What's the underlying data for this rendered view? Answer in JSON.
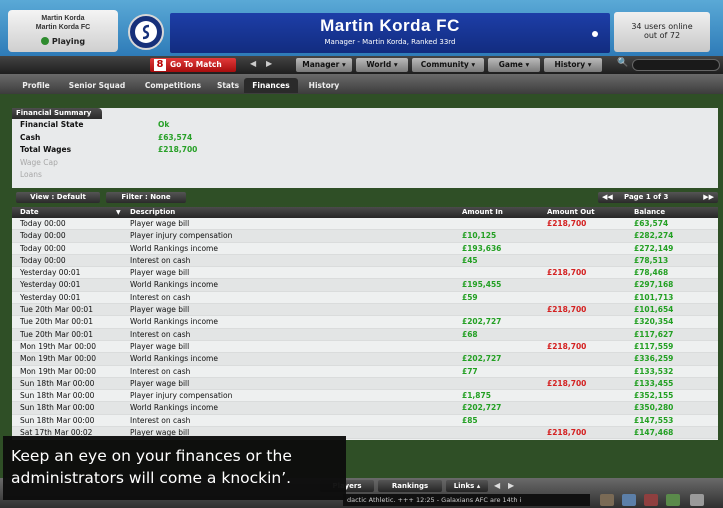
{
  "header": {
    "manager_name": "Martin Korda",
    "team_line": "Martin Korda FC",
    "status": "Playing",
    "club_name": "Martin Korda FC",
    "subtitle": "Manager - Martin Korda, Ranked 33rd",
    "online_line1": "34 users online",
    "online_line2": "out of 72"
  },
  "nav": {
    "go_to_match": "Go To Match",
    "menus": [
      "Manager ▾",
      "World ▾",
      "Community ▾",
      "Game ▾",
      "History ▾"
    ]
  },
  "tabs": [
    "Profile",
    "Senior Squad",
    "Competitions",
    "Stats",
    "Finances",
    "History"
  ],
  "active_tab": "Finances",
  "summary": {
    "title": "Financial Summary",
    "rows": [
      {
        "label": "Financial State",
        "value": "Ok"
      },
      {
        "label": "Cash",
        "value": "£63,574"
      },
      {
        "label": "Total Wages",
        "value": "£218,700"
      },
      {
        "label": "Wage Cap",
        "value": ""
      },
      {
        "label": "Loans",
        "value": ""
      }
    ]
  },
  "toolbar": {
    "view": "View : Default",
    "filter": "Filter : None",
    "page": "Page 1 of 3"
  },
  "table": {
    "headers": [
      "Date",
      "Description",
      "Amount In",
      "Amount Out",
      "Balance"
    ],
    "rows": [
      {
        "date": "Today 00:00",
        "desc": "Player wage bill",
        "in": "",
        "out": "£218,700",
        "bal": "£63,574"
      },
      {
        "date": "Today 00:00",
        "desc": "Player injury compensation",
        "in": "£10,125",
        "out": "",
        "bal": "£282,274"
      },
      {
        "date": "Today 00:00",
        "desc": "World Rankings income",
        "in": "£193,636",
        "out": "",
        "bal": "£272,149"
      },
      {
        "date": "Today 00:00",
        "desc": "Interest on cash",
        "in": "£45",
        "out": "",
        "bal": "£78,513"
      },
      {
        "date": "Yesterday 00:01",
        "desc": "Player wage bill",
        "in": "",
        "out": "£218,700",
        "bal": "£78,468"
      },
      {
        "date": "Yesterday 00:01",
        "desc": "World Rankings income",
        "in": "£195,455",
        "out": "",
        "bal": "£297,168"
      },
      {
        "date": "Yesterday 00:01",
        "desc": "Interest on cash",
        "in": "£59",
        "out": "",
        "bal": "£101,713"
      },
      {
        "date": "Tue 20th Mar 00:01",
        "desc": "Player wage bill",
        "in": "",
        "out": "£218,700",
        "bal": "£101,654"
      },
      {
        "date": "Tue 20th Mar 00:01",
        "desc": "World Rankings income",
        "in": "£202,727",
        "out": "",
        "bal": "£320,354"
      },
      {
        "date": "Tue 20th Mar 00:01",
        "desc": "Interest on cash",
        "in": "£68",
        "out": "",
        "bal": "£117,627"
      },
      {
        "date": "Mon 19th Mar 00:00",
        "desc": "Player wage bill",
        "in": "",
        "out": "£218,700",
        "bal": "£117,559"
      },
      {
        "date": "Mon 19th Mar 00:00",
        "desc": "World Rankings income",
        "in": "£202,727",
        "out": "",
        "bal": "£336,259"
      },
      {
        "date": "Mon 19th Mar 00:00",
        "desc": "Interest on cash",
        "in": "£77",
        "out": "",
        "bal": "£133,532"
      },
      {
        "date": "Sun 18th Mar 00:00",
        "desc": "Player wage bill",
        "in": "",
        "out": "£218,700",
        "bal": "£133,455"
      },
      {
        "date": "Sun 18th Mar 00:00",
        "desc": "Player injury compensation",
        "in": "£1,875",
        "out": "",
        "bal": "£352,155"
      },
      {
        "date": "Sun 18th Mar 00:00",
        "desc": "World Rankings income",
        "in": "£202,727",
        "out": "",
        "bal": "£350,280"
      },
      {
        "date": "Sun 18th Mar 00:00",
        "desc": "Interest on cash",
        "in": "£85",
        "out": "",
        "bal": "£147,553"
      },
      {
        "date": "Sat 17th Mar 00:02",
        "desc": "Player wage bill",
        "in": "",
        "out": "£218,700",
        "bal": "£147,468"
      }
    ]
  },
  "footer": {
    "players": "Players",
    "rankings": "Rankings",
    "links": "Links ▴",
    "ticker": "dactic Athletic. +++ 12:25 - Galaxians AFC are 14th i"
  },
  "caption": "Keep an eye on your finances or the administrators will come a knockin’.",
  "colors": {
    "in": "#23a023",
    "out": "#d42020",
    "title_bar": "#1d3ea8",
    "go_to_match": "#e23a3a"
  }
}
